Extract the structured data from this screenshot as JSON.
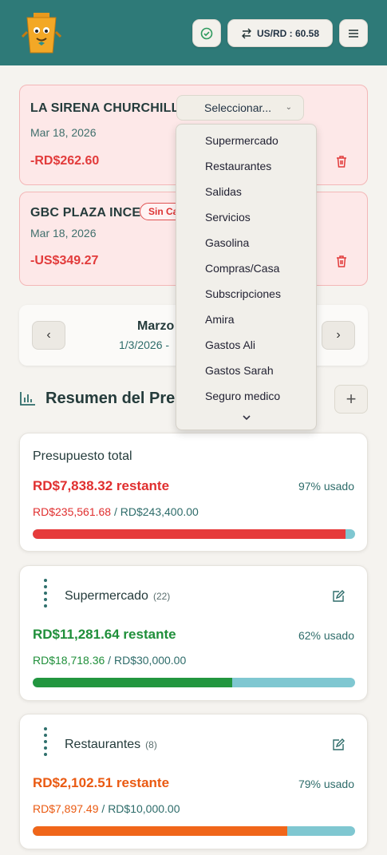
{
  "header": {
    "rate_label": "US/RD : 60.58"
  },
  "transactions": [
    {
      "name": "LA SIRENA CHURCHILL",
      "date": "Mar 18, 2026",
      "amount": "-RD$262.60",
      "select_label": "Seleccionar..."
    },
    {
      "name": "GBC PLAZA INCE",
      "badge": "Sin Ca",
      "date": "Mar 18, 2026",
      "amount": "-US$349.27"
    }
  ],
  "dropdown": {
    "options": [
      "Supermercado",
      "Restaurantes",
      "Salidas",
      "Servicios",
      "Gasolina",
      "Compras/Casa",
      "Subscripciones",
      "Amira",
      "Gastos Ali",
      "Gastos Sarah",
      "Seguro medico"
    ]
  },
  "month_nav": {
    "title": "Marzo",
    "range": "1/3/2026 -"
  },
  "summary": {
    "title": "Resumen del Pres"
  },
  "budget_total": {
    "label": "Presupuesto total",
    "remaining": "RD$7,838.32 restante",
    "pct": "97% usado",
    "spent": "RD$235,561.68",
    "sep": " / ",
    "limit": "RD$243,400.00",
    "used": 0.97,
    "color": "#e63b3b"
  },
  "categories": [
    {
      "label": "Supermercado",
      "count": "(22)",
      "remaining": "RD$11,281.64 restante",
      "pct": "62% usado",
      "spent": "RD$18,718.36",
      "sep": " / ",
      "limit": "RD$30,000.00",
      "used": 0.62,
      "color": "#22963f"
    },
    {
      "label": "Restaurantes",
      "count": "(8)",
      "remaining": "RD$2,102.51 restante",
      "pct": "79% usado",
      "spent": "RD$7,897.49",
      "sep": " / ",
      "limit": "RD$10,000.00",
      "used": 0.79,
      "color": "#f0661a"
    }
  ]
}
